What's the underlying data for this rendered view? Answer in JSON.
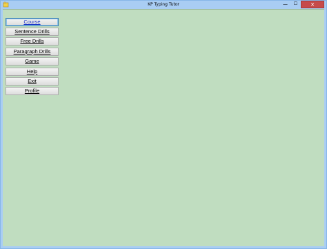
{
  "window": {
    "title": "KP Typing Tutor",
    "controls": {
      "minimize": "—",
      "maximize": "☐",
      "close": "✕"
    }
  },
  "colors": {
    "client_background": "#c0ddc0",
    "titlebar": "#a9cdf3",
    "close_button": "#c64a4a",
    "active_button_text": "#1b33c8"
  },
  "menu": {
    "items": [
      {
        "label": "Course",
        "active": true
      },
      {
        "label": "Sentence Drills",
        "active": false
      },
      {
        "label": "Free Drills",
        "active": false
      },
      {
        "label": "Paragraph Drills",
        "active": false
      },
      {
        "label": "Game",
        "active": false
      },
      {
        "label": "Help",
        "active": false
      },
      {
        "label": "Exit",
        "active": false
      },
      {
        "label": "Profile",
        "active": false
      }
    ]
  }
}
